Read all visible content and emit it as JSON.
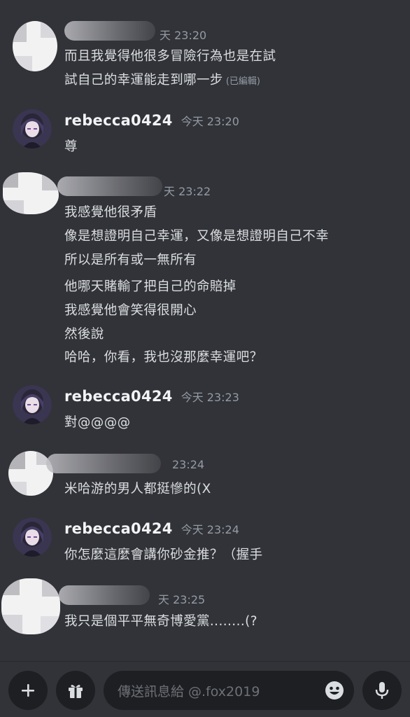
{
  "messages": [
    {
      "author": "",
      "time": "天 23:20",
      "lines": [
        "而且我覺得他很多冒險行為也是在試",
        "試自己的幸運能走到哪一步"
      ],
      "edited": "(已編輯)"
    },
    {
      "author": "rebecca0424",
      "time": "今天 23:20",
      "lines": [
        "尊"
      ]
    },
    {
      "author": "",
      "time": "天 23:22",
      "lines": [
        "我感覺他很矛盾",
        "像是想證明自己幸運，又像是想證明自己不幸",
        "所以是所有或一無所有",
        "他哪天賭輸了把自己的命賠掉",
        "我感覺他會笑得很開心",
        "然後說",
        "哈哈，你看，我也沒那麼幸運吧？"
      ]
    },
    {
      "author": "rebecca0424",
      "time": "今天 23:23",
      "lines": [
        "對@@@@"
      ]
    },
    {
      "author": "",
      "time": "23:24",
      "lines": [
        "米哈游的男人都挺慘的(X"
      ]
    },
    {
      "author": "rebecca0424",
      "time": "今天 23:24",
      "lines": [
        "你怎麼這麼會講你砂金推？（握手"
      ]
    },
    {
      "author": "",
      "time": "天 23:25",
      "lines": [
        "我只是個平平無奇博愛黨........(?"
      ]
    }
  ],
  "composer": {
    "placeholder": "傳送訊息給 @.fox2019",
    "icons": [
      "plus-icon",
      "gift-icon",
      "emoji-icon",
      "microphone-icon"
    ]
  },
  "colors": {
    "background": "#313338",
    "input": "#1e1f22",
    "text": "#dbdee1",
    "username": "#f2f3f5",
    "muted": "#949ba4"
  }
}
